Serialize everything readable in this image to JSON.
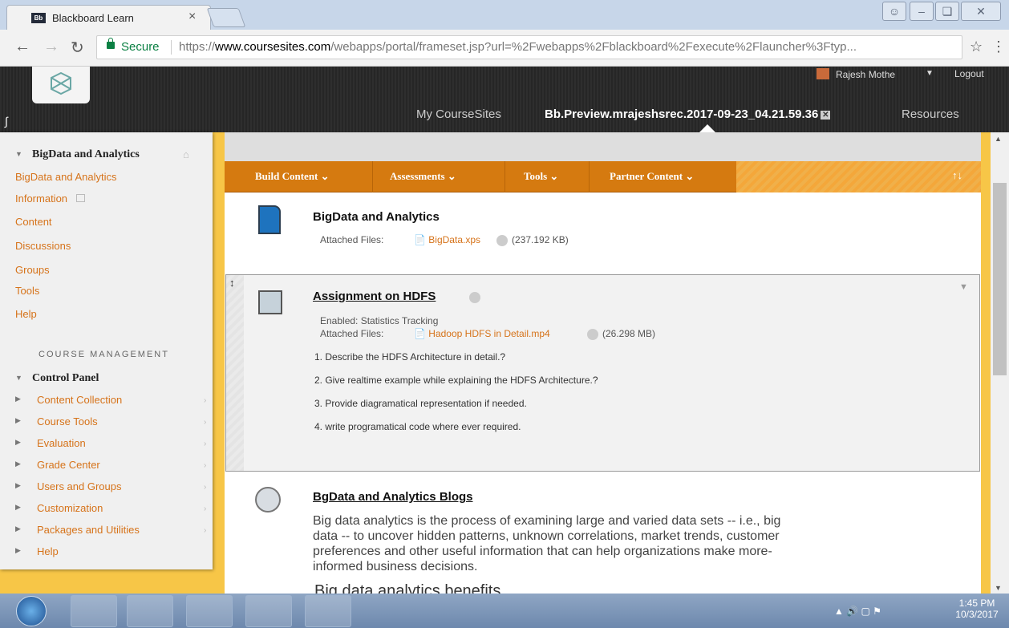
{
  "browser": {
    "tab_title": "Blackboard Learn",
    "tab_favicon": "Bb",
    "secure_label": "Secure",
    "url_scheme": "https://",
    "url_host": "www.coursesites.com",
    "url_rest": "/webapps/portal/frameset.jsp?url=%2Fwebapps%2Fblackboard%2Fexecute%2Flauncher%3Ftyp..."
  },
  "header": {
    "user_name": "Rajesh Mothe",
    "logout_label": "Logout",
    "nav_my": "My CourseSites",
    "crumb": "Bb.Preview.mrajeshsrec.2017-09-23_04.21.59.36",
    "resources": "Resources"
  },
  "sidebar": {
    "course_title": "BigData and Analytics",
    "items": [
      "BigData and Analytics",
      "Information",
      "Content",
      "Discussions",
      "Groups",
      "Tools",
      "Help"
    ],
    "mgmt_label": "COURSE MANAGEMENT",
    "control_panel": "Control Panel",
    "cp_items": [
      "Content Collection",
      "Course Tools",
      "Evaluation",
      "Grade Center",
      "Users and Groups",
      "Customization",
      "Packages and Utilities",
      "Help"
    ]
  },
  "toolbar": {
    "build": "Build Content",
    "assess": "Assessments",
    "tools": "Tools",
    "partner": "Partner Content",
    "sort": "↑↓"
  },
  "items": [
    {
      "title": "BigData and Analytics",
      "files_label": "Attached Files:",
      "file": "BigData.xps",
      "size": "(237.192 KB)"
    },
    {
      "title": "Assignment on HDFS",
      "enabled": "Enabled:  Statistics Tracking",
      "files_label": "Attached Files:",
      "file": "Hadoop HDFS in Detail.mp4",
      "size": "(26.298 MB)",
      "lines": [
        "1. Describe the HDFS Architecture in detail.?",
        "2. Give realtime example while explaining the HDFS Architecture.?",
        "3. Provide diagramatical representation if needed.",
        "4. write programatical code where ever required."
      ]
    },
    {
      "title": "BgData and Analytics Blogs",
      "para": [
        "Big data analytics is the process of examining large and varied data sets -- i.e., big",
        "data -- to uncover hidden patterns, unknown correlations, market trends, customer",
        "preferences and other useful information that can help organizations make more-",
        "informed business decisions."
      ],
      "subhead": "Big data analytics benefits"
    }
  ],
  "clock": {
    "time": "1:45 PM",
    "date": "10/3/2017"
  }
}
